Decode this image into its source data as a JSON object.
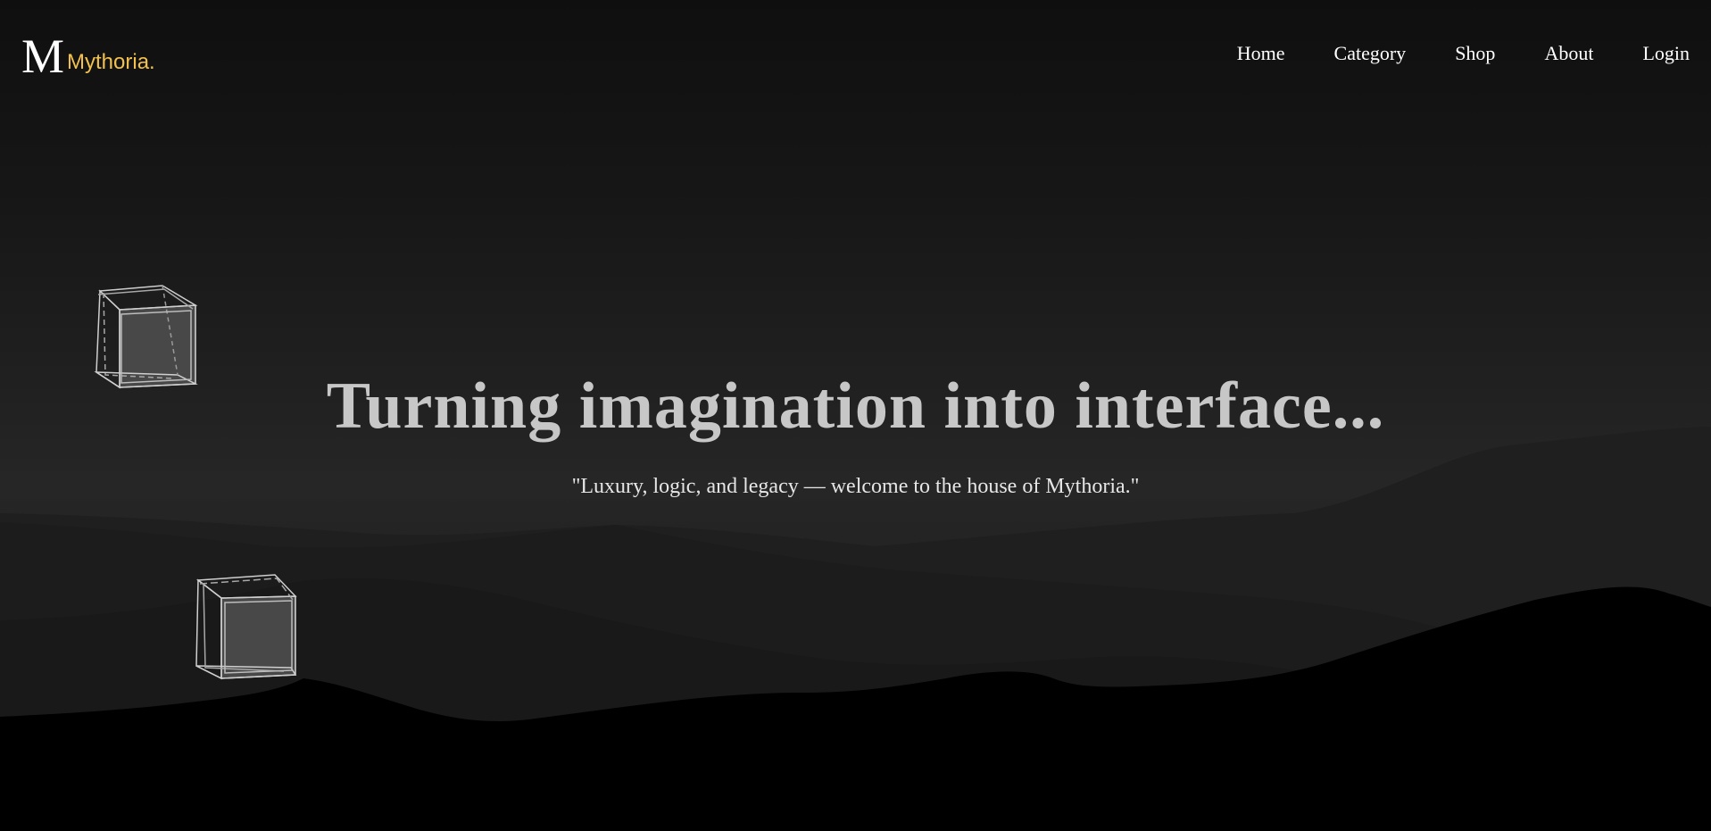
{
  "brand": {
    "mark": "M",
    "name": "Mythoria.",
    "accent_color": "#f2c14e"
  },
  "nav": {
    "items": [
      {
        "label": "Home"
      },
      {
        "label": "Category"
      },
      {
        "label": "Shop"
      },
      {
        "label": "About"
      },
      {
        "label": "Login"
      }
    ]
  },
  "hero": {
    "title": "Turning imagination into interface...",
    "subtitle": "\"Luxury, logic, and legacy — welcome to the house of Mythoria.\""
  },
  "decor": {
    "cube_icon": "wireframe-cube-icon",
    "background": "mountain-silhouette-gradient"
  }
}
